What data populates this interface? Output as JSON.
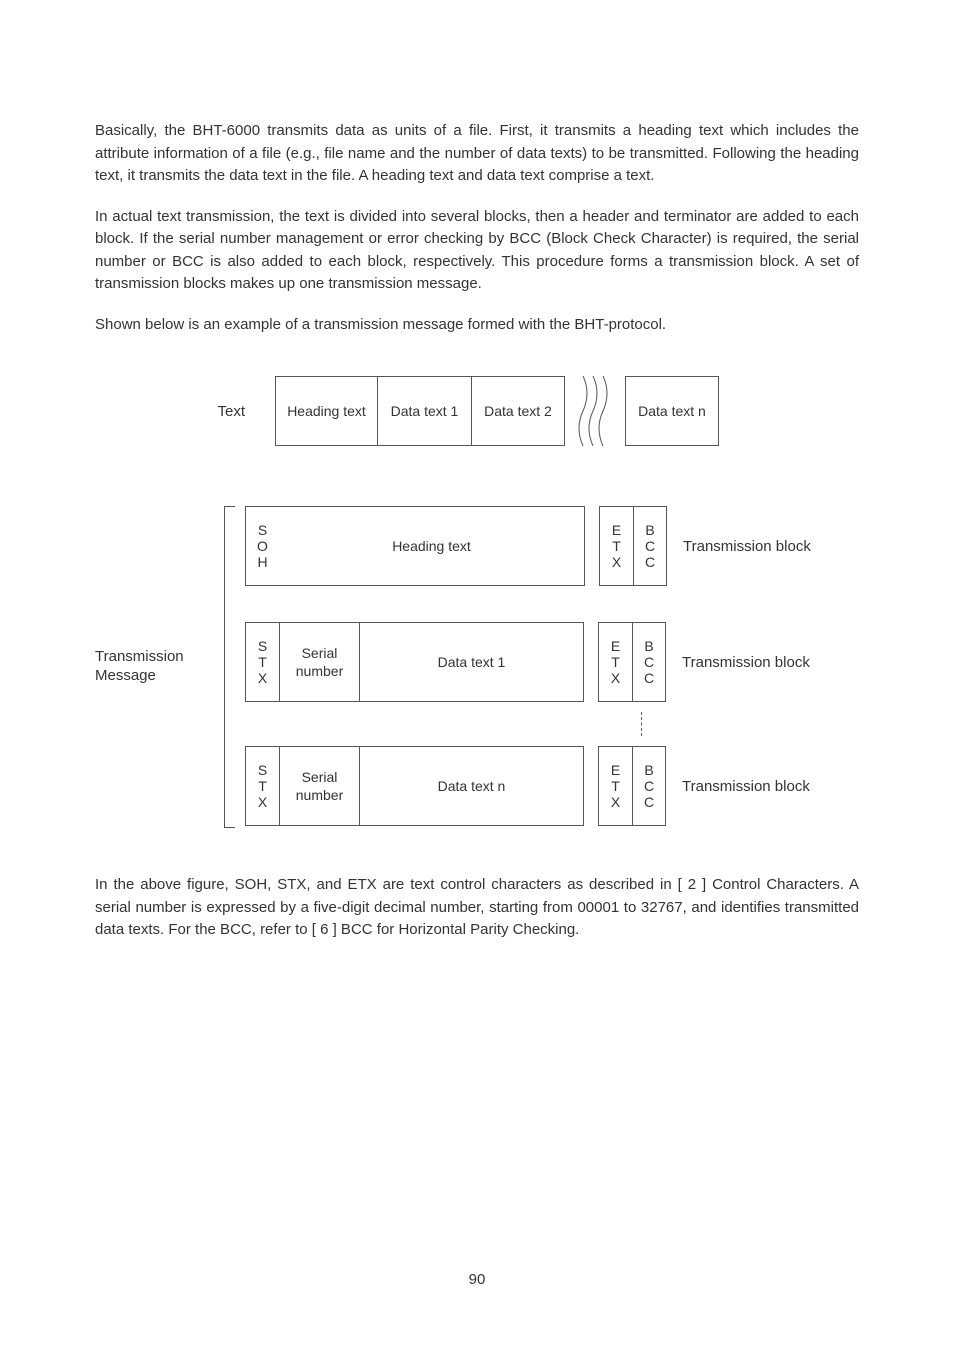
{
  "para1": "Basically, the BHT-6000 transmits data as units of a file.  First, it transmits a heading text which includes the attribute information of a file (e.g., file name and the number of data texts) to be transmitted.  Following the heading text, it transmits the data text in the file.  A heading text and data text comprise a text.",
  "para2": "In actual text transmission, the text is divided into several blocks, then a header and terminator are added to each block.  If the serial number management or error checking by BCC (Block Check Character) is required, the serial number or BCC is also added to each block, respectively.  This procedure forms a transmission block.  A set of transmission blocks makes up one transmission message.",
  "para3": "Shown below is an example of a transmission message formed with the BHT-protocol.",
  "textRow": {
    "label": "Text",
    "heading": "Heading text",
    "dt1": "Data text 1",
    "dt2": "Data text 2",
    "dtn": "Data text n"
  },
  "transLabel": {
    "line1": "Transmission",
    "line2": "Message"
  },
  "block1": {
    "soh": [
      "S",
      "O",
      "H"
    ],
    "heading": "Heading text",
    "etx": [
      "E",
      "T",
      "X"
    ],
    "bcc": [
      "B",
      "C",
      "C"
    ],
    "label": "Transmission block"
  },
  "block2": {
    "stx": [
      "S",
      "T",
      "X"
    ],
    "serial1": "Serial",
    "serial2": "number",
    "data": "Data text 1",
    "etx": [
      "E",
      "T",
      "X"
    ],
    "bcc": [
      "B",
      "C",
      "C"
    ],
    "label": "Transmission block"
  },
  "block3": {
    "stx": [
      "S",
      "T",
      "X"
    ],
    "serial1": "Serial",
    "serial2": "number",
    "data": "Data text n",
    "etx": [
      "E",
      "T",
      "X"
    ],
    "bcc": [
      "B",
      "C",
      "C"
    ],
    "label": "Transmission block"
  },
  "para4": "In the above figure, SOH, STX, and ETX are text control characters as described in [ 2 ] Control Characters.  A serial number is expressed by a five-digit decimal number, starting from 00001 to 32767, and identifies transmitted data texts.  For the BCC, refer to [ 6 ] BCC for Horizontal Parity Checking.",
  "pageNum": "90"
}
